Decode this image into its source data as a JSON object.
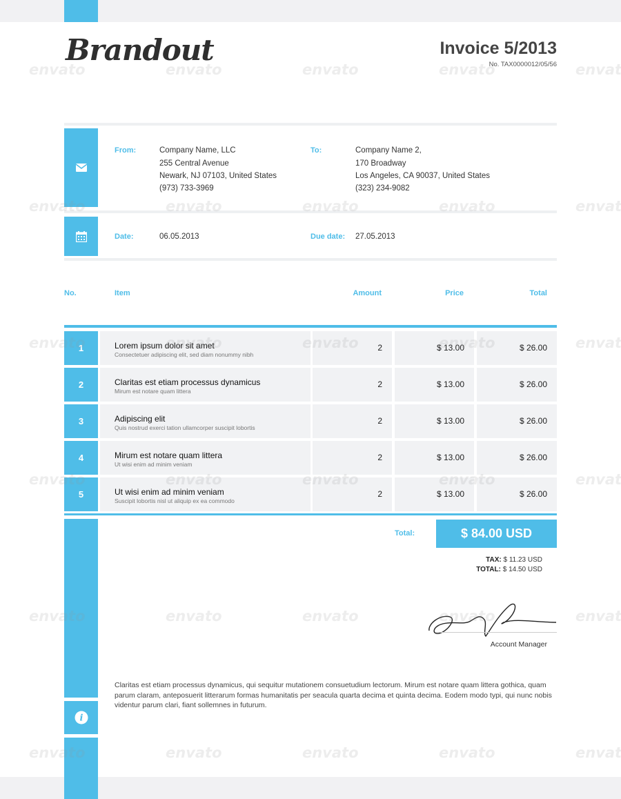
{
  "brand": {
    "logo": "Brandout"
  },
  "invoice": {
    "title": "Invoice 5/2013",
    "number": "No. TAX0000012/05/56"
  },
  "from": {
    "label": "From:",
    "lines": [
      "Company Name, LLC",
      "255 Central Avenue",
      "Newark, NJ 07103, United States",
      "(973) 733-3969"
    ]
  },
  "to": {
    "label": "To:",
    "lines": [
      "Company Name 2,",
      "170 Broadway",
      "Los Angeles, CA 90037, United States",
      "(323) 234-9082"
    ]
  },
  "dates": {
    "date_label": "Date:",
    "date": "06.05.2013",
    "due_label": "Due date:",
    "due": "27.05.2013"
  },
  "table": {
    "headers": {
      "no": "No.",
      "item": "Item",
      "amount": "Amount",
      "price": "Price",
      "total": "Total"
    },
    "rows": [
      {
        "no": "1",
        "name": "Lorem ipsum dolor sit amet",
        "desc": "Consectetuer adipiscing elit, sed diam nonummy nibh",
        "amount": "2",
        "price": "$ 13.00",
        "total": "$ 26.00"
      },
      {
        "no": "2",
        "name": "Claritas est etiam processus dynamicus",
        "desc": "Mirum est notare quam littera",
        "amount": "2",
        "price": "$ 13.00",
        "total": "$ 26.00"
      },
      {
        "no": "3",
        "name": "Adipiscing elit",
        "desc": "Quis nostrud exerci tation ullamcorper suscipit lobortis",
        "amount": "2",
        "price": "$ 13.00",
        "total": "$ 26.00"
      },
      {
        "no": "4",
        "name": "Mirum est notare quam littera",
        "desc": "Ut wisi enim ad minim veniam",
        "amount": "2",
        "price": "$ 13.00",
        "total": "$ 26.00"
      },
      {
        "no": "5",
        "name": "Ut wisi enim ad minim veniam",
        "desc": "Suscipit lobortis nisl ut aliquip ex ea commodo",
        "amount": "2",
        "price": "$ 13.00",
        "total": "$ 26.00"
      }
    ]
  },
  "totals": {
    "label": "Total:",
    "value": "$ 84.00 USD",
    "tax_label": "TAX:",
    "tax_value": "$ 11.23 USD",
    "total2_label": "TOTAL:",
    "total2_value": "$ 14.50 USD"
  },
  "signature": {
    "title": "Account Manager"
  },
  "footer": {
    "text": "Claritas est etiam processus dynamicus, qui sequitur mutationem consuetudium lectorum. Mirum est notare quam littera gothica, quam parum claram, anteposuerit litterarum formas humanitatis per seacula quarta decima et quinta decima. Eodem modo typi, qui nunc nobis videntur parum clari, fiant sollemnes in futurum."
  },
  "watermark": {
    "text": "envato"
  },
  "colors": {
    "accent": "#4fbde8",
    "cell_bg": "#f1f2f4"
  },
  "icons": {
    "from": "envelope-icon",
    "date": "calendar-icon",
    "footer": "info-icon"
  }
}
